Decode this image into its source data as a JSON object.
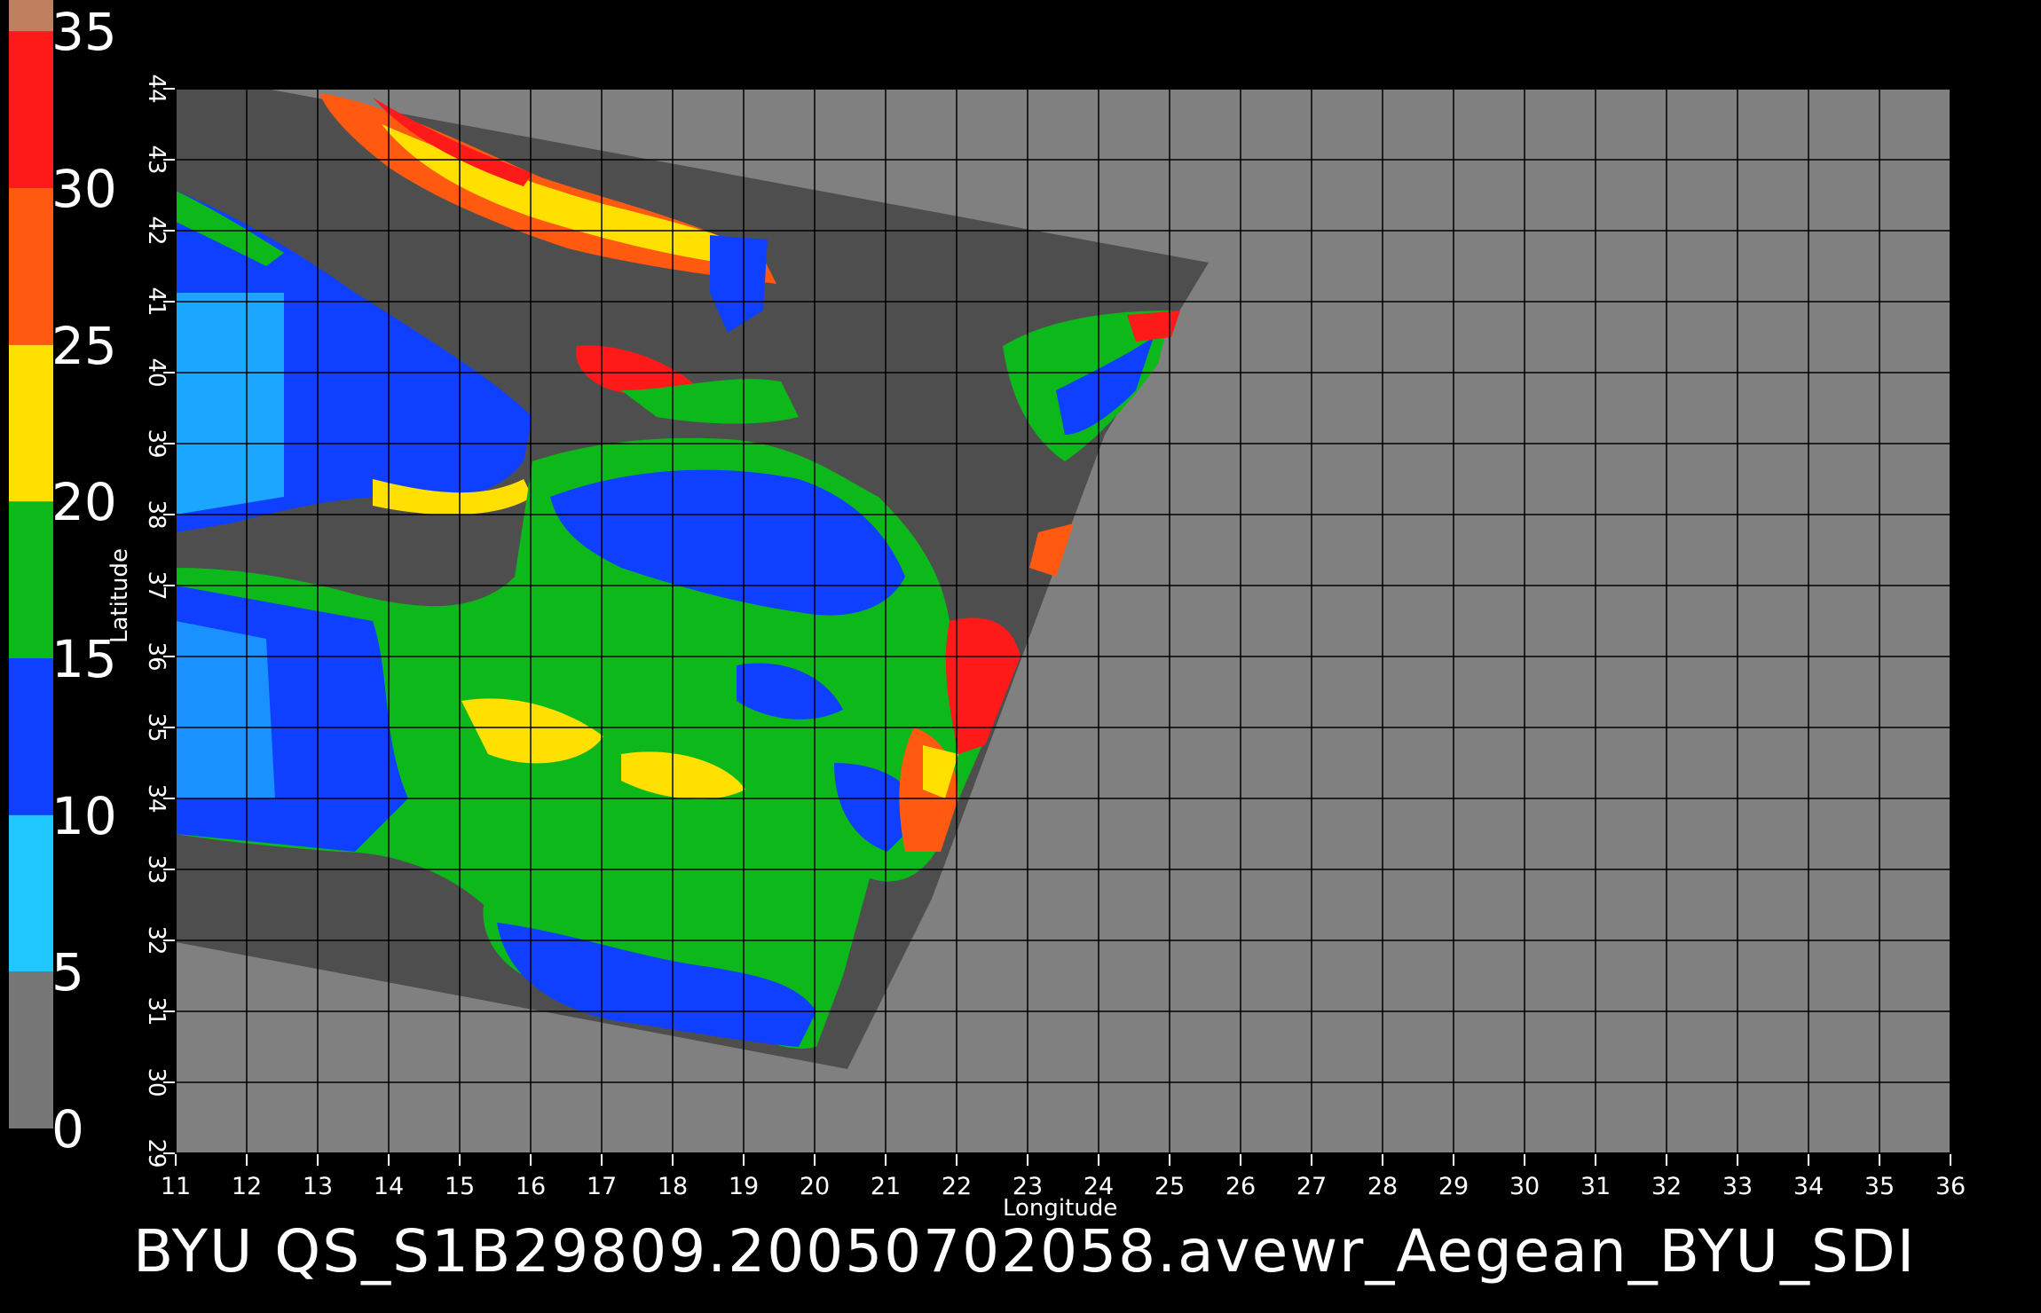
{
  "colorbar": {
    "labels": [
      "35",
      "30",
      "25",
      "20",
      "15",
      "10",
      "5",
      "0"
    ],
    "min": 0,
    "max": 36,
    "bands": [
      {
        "from": 0,
        "to": 5,
        "color": "#777777"
      },
      {
        "from": 5,
        "to": 10,
        "color": "#1fc8ff"
      },
      {
        "from": 10,
        "to": 15,
        "color": "#1040ff"
      },
      {
        "from": 15,
        "to": 20,
        "color": "#0cb81a"
      },
      {
        "from": 20,
        "to": 25,
        "color": "#ffe000"
      },
      {
        "from": 25,
        "to": 30,
        "color": "#ff5a10"
      },
      {
        "from": 30,
        "to": 35,
        "color": "#ff1a1a"
      },
      {
        "from": 35,
        "to": 36,
        "color": "#c08060"
      }
    ]
  },
  "map": {
    "xlabel": "Longitude",
    "ylabel": "Latitude",
    "lon_range": [
      11,
      36
    ],
    "lat_range": [
      29,
      44
    ],
    "lon_ticks": [
      "11",
      "12",
      "13",
      "14",
      "15",
      "16",
      "17",
      "18",
      "19",
      "20",
      "21",
      "22",
      "23",
      "24",
      "25",
      "26",
      "27",
      "28",
      "29",
      "30",
      "31",
      "32",
      "33",
      "34",
      "35",
      "36"
    ],
    "lat_ticks": [
      "29",
      "30",
      "31",
      "32",
      "33",
      "34",
      "35",
      "36",
      "37",
      "38",
      "39",
      "40",
      "41",
      "42",
      "43",
      "44"
    ],
    "background_color": "#808080",
    "swath_color": "#4e4e4e",
    "grid": true
  },
  "caption": "BYU  QS_S1B29809.20050702058.avewr_Aegean_BYU_SDI"
}
